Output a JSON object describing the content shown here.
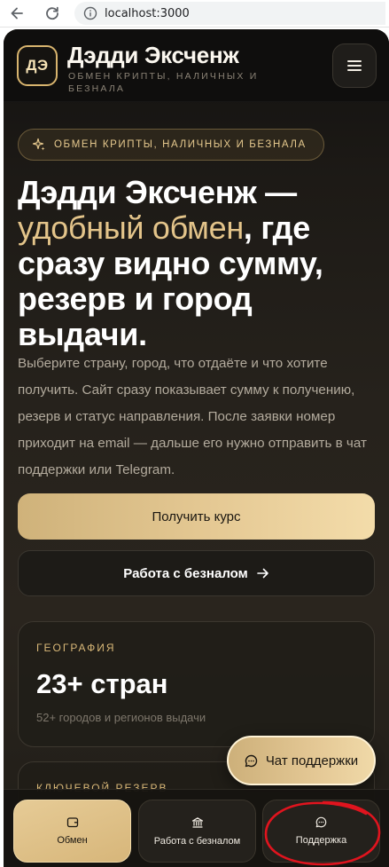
{
  "browser": {
    "url": "localhost:3000"
  },
  "header": {
    "logo_text": "ДЭ",
    "brand_name": "Дэдди Эксченж",
    "tagline": "Обмен крипты, наличных и безнала"
  },
  "badge": {
    "text": "Обмен крипты, наличных и безнала"
  },
  "hero": {
    "title_part1": "Дэдди Эксченж — ",
    "title_accent": "удобный обмен",
    "title_part2": ", где сразу видно сумму, резерв и город выдачи.",
    "description": "Выберите страну, город, что отдаёте и что хотите получить. Сайт сразу показывает сумму к получению, резерв и статус направления. После заявки номер приходит на email — дальше его нужно отправить в чат поддержки или Telegram."
  },
  "buttons": {
    "primary_label": "Получить курс",
    "secondary_label": "Работа с безналом"
  },
  "stats": [
    {
      "label": "География",
      "value": "23+ стран",
      "sub": "52+ городов и регионов выдачи"
    },
    {
      "label": "Ключевой резерв",
      "value": "",
      "sub": ""
    }
  ],
  "chat_float": {
    "label": "Чат поддержки"
  },
  "bottom_nav": {
    "items": [
      {
        "label": "Обмен",
        "icon": "wallet-icon",
        "active": true
      },
      {
        "label": "Работа с безналом",
        "icon": "bank-icon",
        "active": false
      },
      {
        "label": "Поддержка",
        "icon": "chat-icon",
        "active": false
      }
    ]
  },
  "colors": {
    "accent_gold": "#e3c48a",
    "background_dark": "#1d1a16",
    "annotation_red": "#e0141e"
  }
}
